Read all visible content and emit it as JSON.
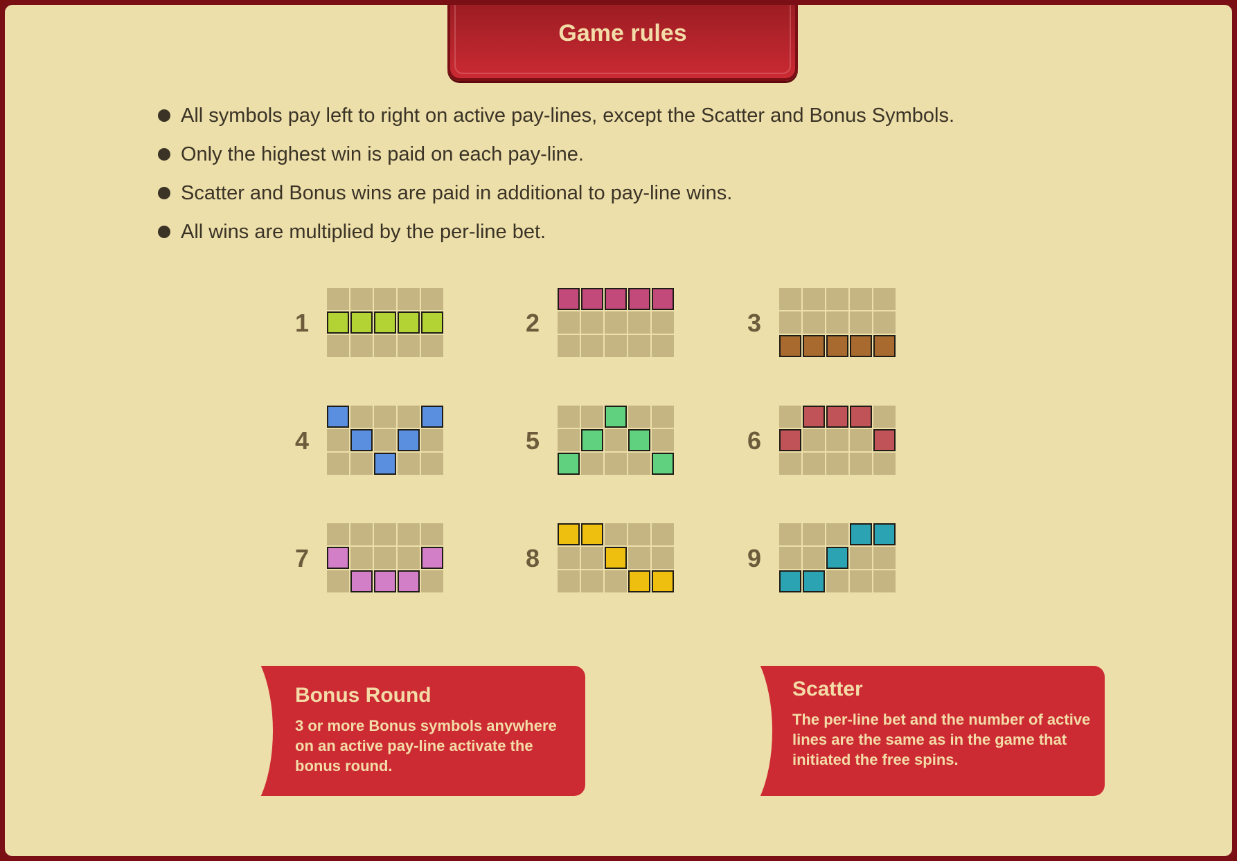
{
  "title": "Game rules",
  "rules": [
    "All symbols pay left to right on active pay-lines, except the Scatter and Bonus Symbols.",
    "Only the highest win is paid on each pay-line.",
    "Scatter and Bonus wins are paid in additional to pay-line wins.",
    "All wins are multiplied by the per-line bet."
  ],
  "paylines": [
    {
      "label": "1",
      "color": "#b3d233",
      "rows": [
        1,
        1,
        1,
        1,
        1
      ]
    },
    {
      "label": "2",
      "color": "#c24a7b",
      "rows": [
        0,
        0,
        0,
        0,
        0
      ]
    },
    {
      "label": "3",
      "color": "#a86a2e",
      "rows": [
        2,
        2,
        2,
        2,
        2
      ]
    },
    {
      "label": "4",
      "color": "#5a8fe0",
      "rows": [
        0,
        1,
        2,
        1,
        0
      ]
    },
    {
      "label": "5",
      "color": "#5fd17f",
      "rows": [
        2,
        1,
        0,
        1,
        2
      ]
    },
    {
      "label": "6",
      "color": "#c05357",
      "rows": [
        1,
        0,
        0,
        0,
        1
      ]
    },
    {
      "label": "7",
      "color": "#d37fc8",
      "rows": [
        1,
        2,
        2,
        2,
        1
      ]
    },
    {
      "label": "8",
      "color": "#efbf10",
      "rows": [
        0,
        0,
        1,
        2,
        2
      ]
    },
    {
      "label": "9",
      "color": "#2ba3b3",
      "rows": [
        2,
        2,
        1,
        0,
        0
      ]
    }
  ],
  "bonus": {
    "title": "Bonus Round",
    "text": "3 or more Bonus symbols anywhere on an active pay-line activate the bonus round."
  },
  "scatter": {
    "title": "Scatter",
    "text": "The per-line bet and the number of active lines are the same as in the game that initiated the free spins."
  }
}
